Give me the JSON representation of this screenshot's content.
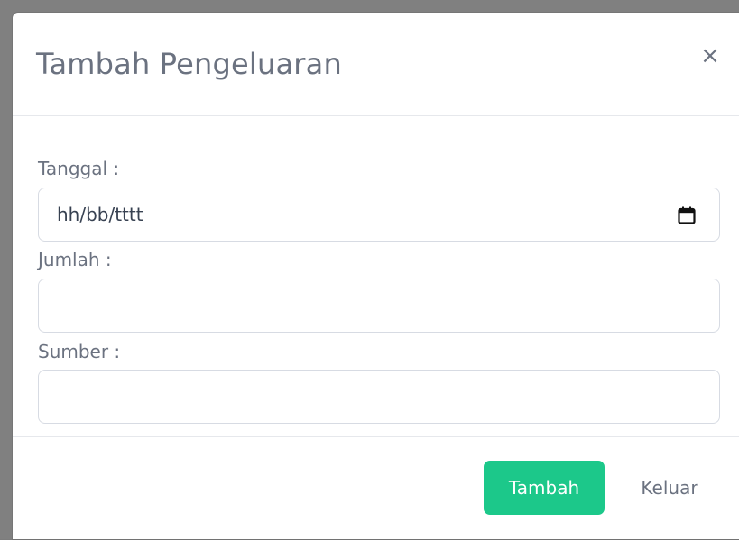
{
  "modal": {
    "title": "Tambah Pengeluaran",
    "close_symbol": "×"
  },
  "form": {
    "tanggal_label": "Tanggal :",
    "tanggal_placeholder": "hh/bb/tttt",
    "jumlah_label": "Jumlah :",
    "jumlah_value": "",
    "sumber_label": "Sumber :",
    "sumber_value": ""
  },
  "footer": {
    "submit_label": "Tambah",
    "exit_label": "Keluar"
  },
  "icons": {
    "close": "close-icon",
    "calendar": "calendar-icon"
  },
  "colors": {
    "primary": "#1cc88a",
    "text_muted": "#6b7280",
    "border": "#d7dbe3"
  }
}
